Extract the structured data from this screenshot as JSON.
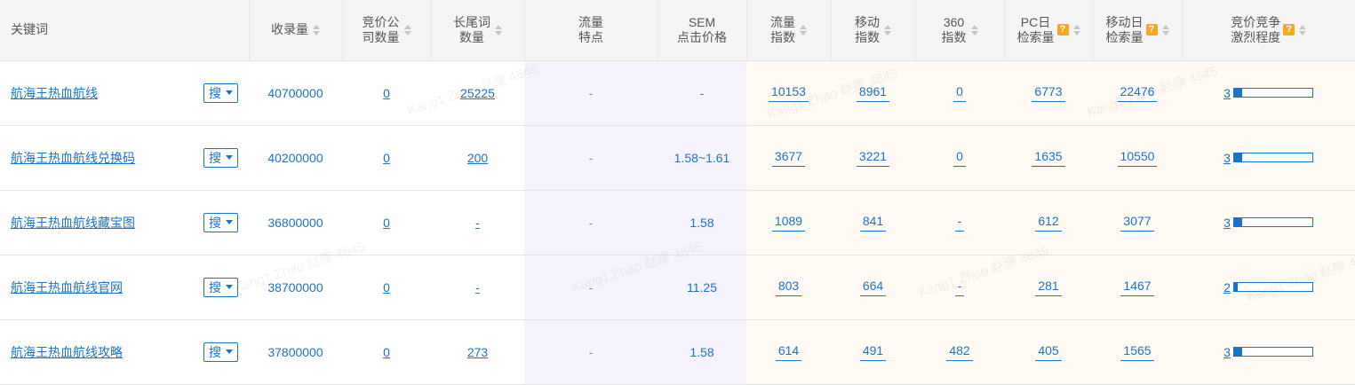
{
  "headers": {
    "keyword": "关键词",
    "index_count": "收录量",
    "bid_companies": [
      "竞价公",
      "司数量"
    ],
    "long_tail": [
      "长尾词",
      "数量"
    ],
    "traffic_feature": [
      "流量",
      "特点"
    ],
    "sem_price": [
      "SEM",
      "点击价格"
    ],
    "traffic_index": [
      "流量",
      "指数"
    ],
    "mobile_index": [
      "移动",
      "指数"
    ],
    "index_360": [
      "360",
      "指数"
    ],
    "pc_daily": [
      "PC日",
      "检索量"
    ],
    "mobile_daily": [
      "移动日",
      "检索量"
    ],
    "competition": [
      "竞价竞争",
      "激烈程度"
    ],
    "help_mark": "?"
  },
  "search_button_label": "搜",
  "rows": [
    {
      "keyword": "航海王热血航线",
      "index_count": "40700000",
      "bid_companies": "0",
      "long_tail": "25225",
      "traffic_feature": "-",
      "sem_price": "-",
      "traffic_index": "10153",
      "mobile_index": "8961",
      "index_360": "0",
      "pc_daily": "6773",
      "mobile_daily": "22476",
      "competition": "3",
      "competition_level": 0.1
    },
    {
      "keyword": "航海王热血航线兑换码",
      "index_count": "40200000",
      "bid_companies": "0",
      "long_tail": "200",
      "traffic_feature": "-",
      "sem_price": "1.58~1.61",
      "traffic_index": "3677",
      "mobile_index": "3221",
      "index_360": "0",
      "pc_daily": "1635",
      "mobile_daily": "10550",
      "competition": "3",
      "competition_level": 0.1
    },
    {
      "keyword": "航海王热血航线藏宝图",
      "index_count": "36800000",
      "bid_companies": "0",
      "long_tail": "-",
      "traffic_feature": "-",
      "sem_price": "1.58",
      "traffic_index": "1089",
      "mobile_index": "841",
      "index_360": "-",
      "pc_daily": "612",
      "mobile_daily": "3077",
      "competition": "3",
      "competition_level": 0.1
    },
    {
      "keyword": "航海王热血航线官网",
      "index_count": "38700000",
      "bid_companies": "0",
      "long_tail": "-",
      "traffic_feature": "-",
      "sem_price": "11.25",
      "traffic_index": "803",
      "mobile_index": "664",
      "index_360": "-",
      "pc_daily": "281",
      "mobile_daily": "1467",
      "competition": "2",
      "competition_level": 0.05
    },
    {
      "keyword": "航海王热血航线攻略",
      "index_count": "37800000",
      "bid_companies": "0",
      "long_tail": "273",
      "traffic_feature": "-",
      "sem_price": "1.58",
      "traffic_index": "614",
      "mobile_index": "491",
      "index_360": "482",
      "pc_daily": "405",
      "mobile_daily": "1565",
      "competition": "3",
      "competition_level": 0.1
    }
  ],
  "watermark": "Kang1 Zhao 赵康 4645",
  "colors": {
    "link": "#1a73c9",
    "purple_band": "#f7f3fd",
    "peach_band": "#fffaf3",
    "help_badge": "#f5a623"
  }
}
